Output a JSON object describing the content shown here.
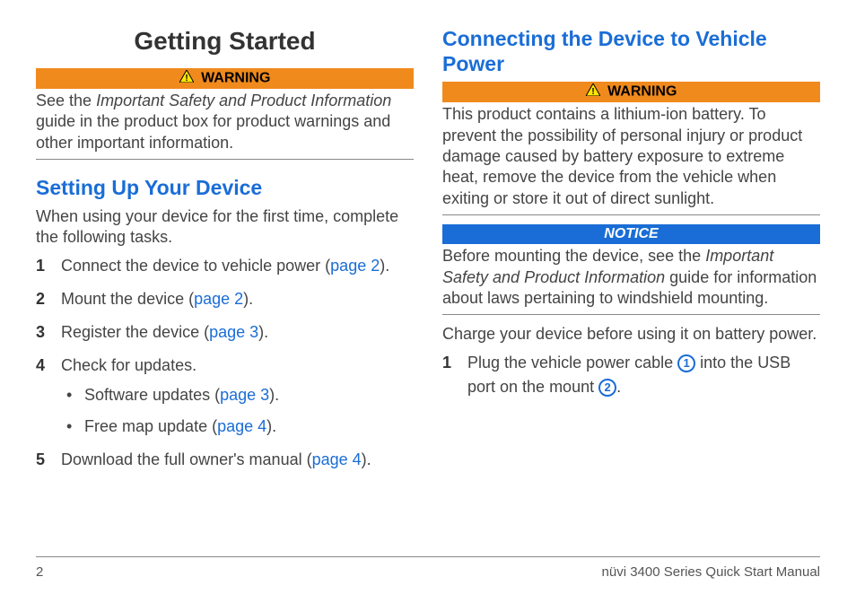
{
  "labels": {
    "warning": "WARNING",
    "notice": "NOTICE"
  },
  "col1": {
    "title": "Getting Started",
    "warn_pre": "See the ",
    "warn_em": "Important Safety and Product Information",
    "warn_post": " guide in the product box for product warnings and other important information.",
    "h2": "Setting Up Your Device",
    "intro": "When using your device for the first time, complete the following tasks.",
    "s1a": "Connect the device to vehicle power (",
    "s1link": "page 2",
    "s1b": ").",
    "s2a": "Mount the device (",
    "s2link": "page 2",
    "s2b": ").",
    "s3a": "Register the device (",
    "s3link": "page 3",
    "s3b": ").",
    "s4": "Check for updates.",
    "s4ba": "Software updates (",
    "s4blink": "page 3",
    "s4bb": ").",
    "s4ca": "Free map update (",
    "s4clink": "page 4",
    "s4cb": ").",
    "s5a": "Download the full owner's manual (",
    "s5link": "page 4",
    "s5b": ")."
  },
  "col2": {
    "h2": "Connecting the Device to Vehicle Power",
    "warn": "This product contains a lithium-ion battery. To prevent the possibility of personal injury or product damage caused by battery exposure to extreme heat, remove the device from the vehicle when exiting or store it out of direct sunlight.",
    "notice_pre": "Before mounting the device, see the ",
    "notice_em": "Important Safety and Product Information",
    "notice_post": " guide for information about laws pertaining to windshield mounting.",
    "charge": "Charge your device before using it on battery power.",
    "s1a": "Plug the vehicle power cable ",
    "s1mid": " into the USB port on the mount ",
    "s1end": ".",
    "c1": "1",
    "c2": "2"
  },
  "footer": {
    "page": "2",
    "title": "nüvi 3400 Series Quick Start Manual"
  }
}
